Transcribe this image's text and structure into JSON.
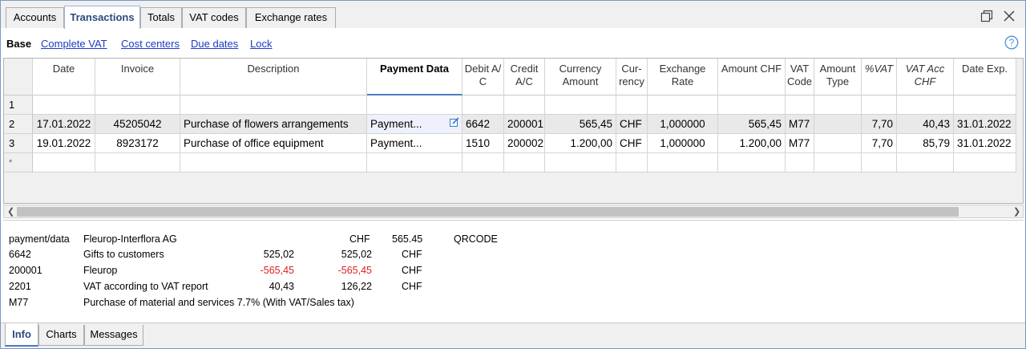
{
  "tabs": [
    "Accounts",
    "Transactions",
    "Totals",
    "VAT codes",
    "Exchange rates"
  ],
  "view_links": [
    "Base",
    "Complete VAT",
    "Cost centers",
    "Due dates",
    "Lock"
  ],
  "icons": {
    "restore": "restore-window-icon",
    "close": "close-icon",
    "help": "help-icon",
    "edit": "edit-icon"
  },
  "columns": [
    {
      "label": "Date"
    },
    {
      "label": "Invoice"
    },
    {
      "label": "Description"
    },
    {
      "label": "Payment Data",
      "bold": true
    },
    {
      "label": "Debit A/\nC"
    },
    {
      "label": "Credit\nA/C"
    },
    {
      "label": "Currency\nAmount"
    },
    {
      "label": "Cur-\nrency"
    },
    {
      "label": "Exchange\nRate"
    },
    {
      "label": "Amount CHF"
    },
    {
      "label": "VAT\nCode"
    },
    {
      "label": "Amount\nType"
    },
    {
      "label": "%VAT",
      "italic": true
    },
    {
      "label": "VAT Acc\nCHF",
      "italic": true
    },
    {
      "label": "Date Exp."
    }
  ],
  "rows": [
    {
      "num": "1",
      "cells": [
        "",
        "",
        "",
        "",
        "",
        "",
        "",
        "",
        "",
        "",
        "",
        "",
        "",
        "",
        ""
      ]
    },
    {
      "num": "2",
      "selected": true,
      "cells": [
        "17.01.2022",
        "45205042",
        "Purchase of flowers arrangements",
        "Payment...",
        "6642",
        "200001",
        "565,45",
        "CHF",
        "1,000000",
        "565,45",
        "M77",
        "",
        "7,70",
        "40,43",
        "31.01.2022"
      ]
    },
    {
      "num": "3",
      "cells": [
        "19.01.2022",
        "8923172",
        "Purchase of office equipment",
        "Payment...",
        "1510",
        "200002",
        "1.200,00",
        "CHF",
        "1,000000",
        "1.200,00",
        "M77",
        "",
        "7,70",
        "85,79",
        "31.01.2022"
      ]
    },
    {
      "num": "*",
      "star": true,
      "cells": [
        "",
        "",
        "",
        "",
        "",
        "",
        "",
        "",
        "",
        "",
        "",
        "",
        "",
        "",
        ""
      ]
    }
  ],
  "info": {
    "payment": {
      "key": "payment/data",
      "name": "Fleurop-Interflora AG",
      "currency": "CHF",
      "amount": "565.45",
      "extra": "QRCODE"
    },
    "lines": [
      {
        "account": "6642",
        "label": "Gifts to customers",
        "amount": "525,02",
        "total": "525,02",
        "currency": "CHF",
        "negative": false
      },
      {
        "account": "200001",
        "label": "Fleurop",
        "amount": "-565,45",
        "total": "-565,45",
        "currency": "CHF",
        "negative": true
      },
      {
        "account": "2201",
        "label": "VAT according to VAT report",
        "amount": "40,43",
        "total": "126,22",
        "currency": "CHF",
        "negative": false
      }
    ],
    "vat": {
      "code": "M77",
      "description": "Purchase of material and services 7.7% (With VAT/Sales tax)"
    }
  },
  "bottom_tabs": [
    "Info",
    "Charts",
    "Messages"
  ],
  "colors": {
    "link": "#1a3cc8",
    "active_tab_text": "#2c4a7f",
    "negative": "#e02020",
    "selected_row": "#e9e9e9"
  }
}
